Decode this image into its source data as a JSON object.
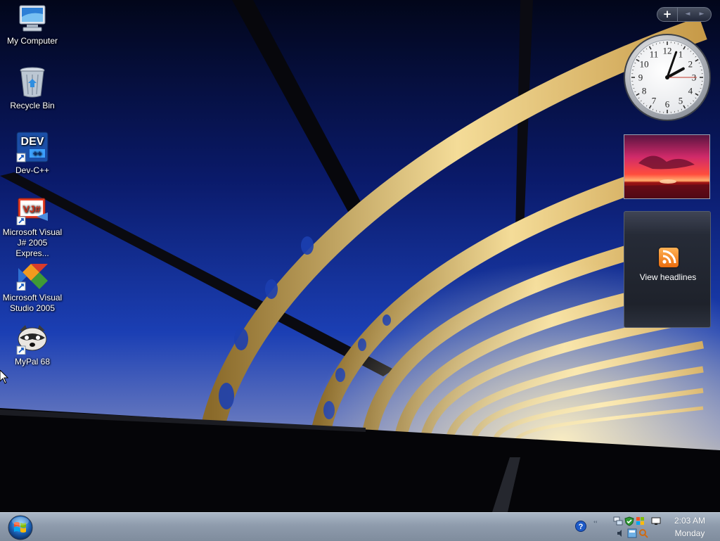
{
  "desktop": {
    "icons": [
      {
        "label_1": "My Computer",
        "label_2": ""
      },
      {
        "label_1": "Recycle Bin",
        "label_2": ""
      },
      {
        "label_1": "Dev-C++",
        "label_2": ""
      },
      {
        "label_1": "Microsoft Visual",
        "label_2": "J# 2005 Expres..."
      },
      {
        "label_1": "Microsoft Visual",
        "label_2": "Studio 2005"
      },
      {
        "label_1": "MyPal 68",
        "label_2": ""
      }
    ],
    "dev_logo_text": "DEV",
    "vj_logo_text": "VJ#"
  },
  "sidebar": {
    "add_label": "+",
    "prev_label": "◄",
    "next_label": "►",
    "clock": {
      "hour": 2,
      "minute": 3,
      "second": 15,
      "numerals": [
        "12",
        "1",
        "2",
        "3",
        "4",
        "5",
        "6",
        "7",
        "8",
        "9",
        "10",
        "11"
      ]
    },
    "feed": {
      "headline_label": "View headlines"
    }
  },
  "taskbar": {
    "time": "2:03 AM",
    "day": "Monday",
    "help_label": "?",
    "chevron": "‹‹",
    "accent": "#1a7fd8"
  }
}
